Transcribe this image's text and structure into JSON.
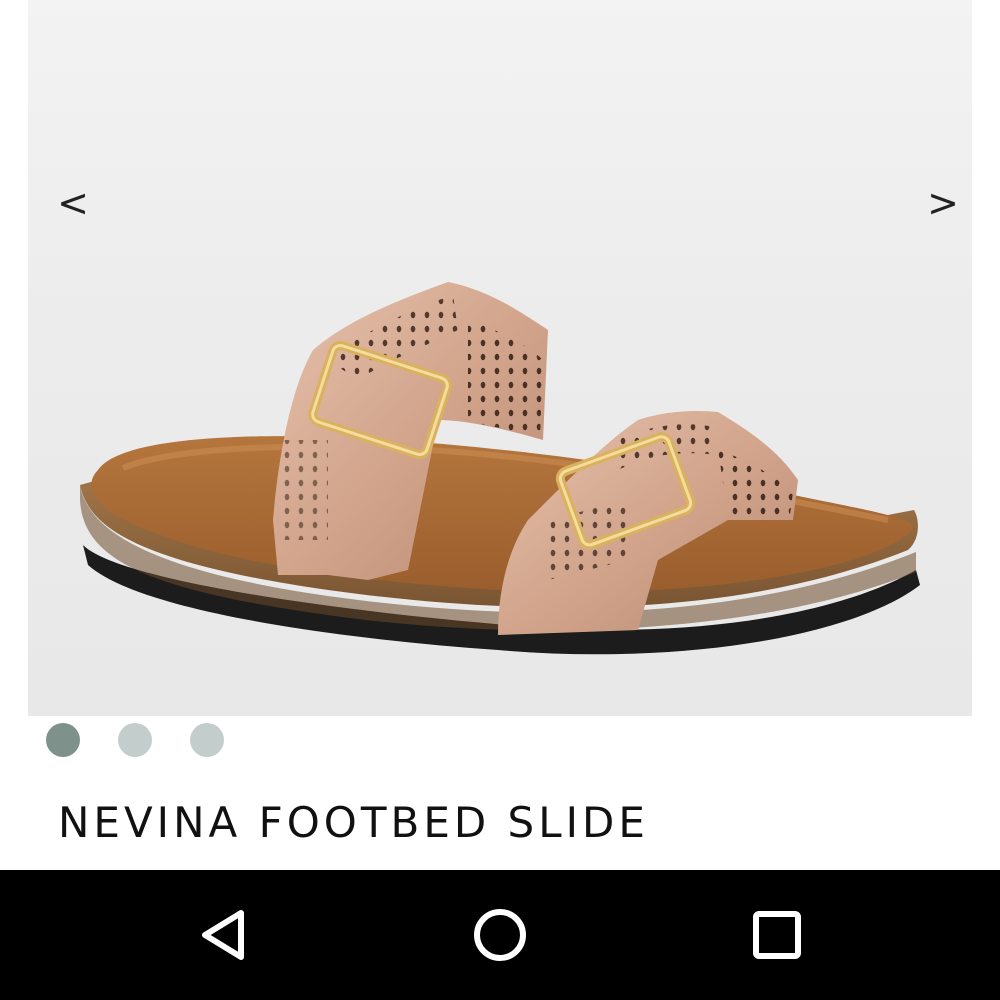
{
  "gallery": {
    "prev_label": "<",
    "next_label": ">",
    "image_subject": "rose-gold two-strap footbed slide sandal",
    "dots_count": 3,
    "active_index": 0,
    "dot_colors": {
      "active": "#7e918b",
      "inactive": "#c3cdcb"
    }
  },
  "product": {
    "title": "NEVINA FOOTBED SLIDE"
  },
  "navbar": {
    "buttons": [
      "back-icon",
      "home-icon",
      "recents-icon"
    ]
  }
}
